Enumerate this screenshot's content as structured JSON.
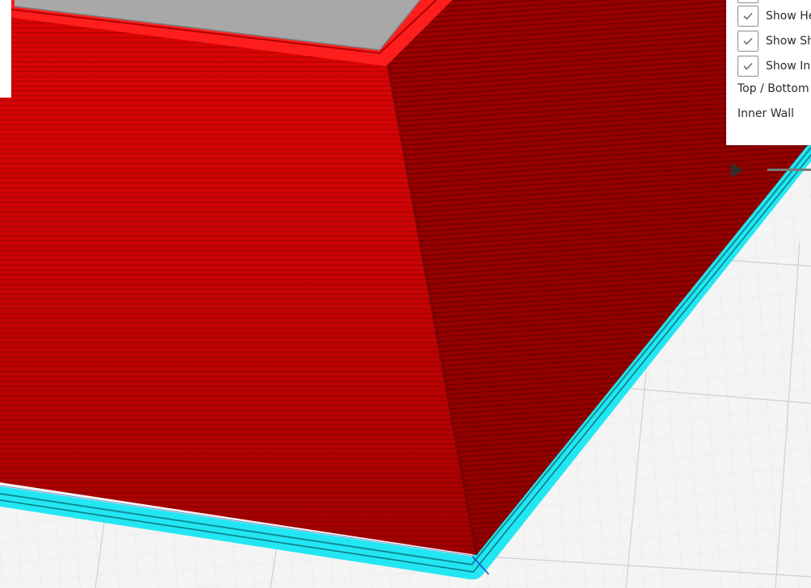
{
  "view_options": {
    "items": [
      {
        "label": "Show He",
        "checked": true
      },
      {
        "label": "Show Sh",
        "checked": true
      },
      {
        "label": "Show In",
        "checked": true
      }
    ]
  },
  "legend": {
    "items": [
      {
        "label": "Top / Bottom"
      },
      {
        "label": "Inner Wall"
      }
    ]
  },
  "colors": {
    "outer_wall": "#d10000",
    "top_bottom": "#ff2020",
    "skirt": "#22e7f2",
    "build_plate": "#f4f4f4",
    "gridline": "#dcdcdc",
    "top_surface": "#a8a8a8"
  },
  "icons": {
    "checkbox": "check-icon",
    "layer_marker": "play-triangle-icon"
  }
}
